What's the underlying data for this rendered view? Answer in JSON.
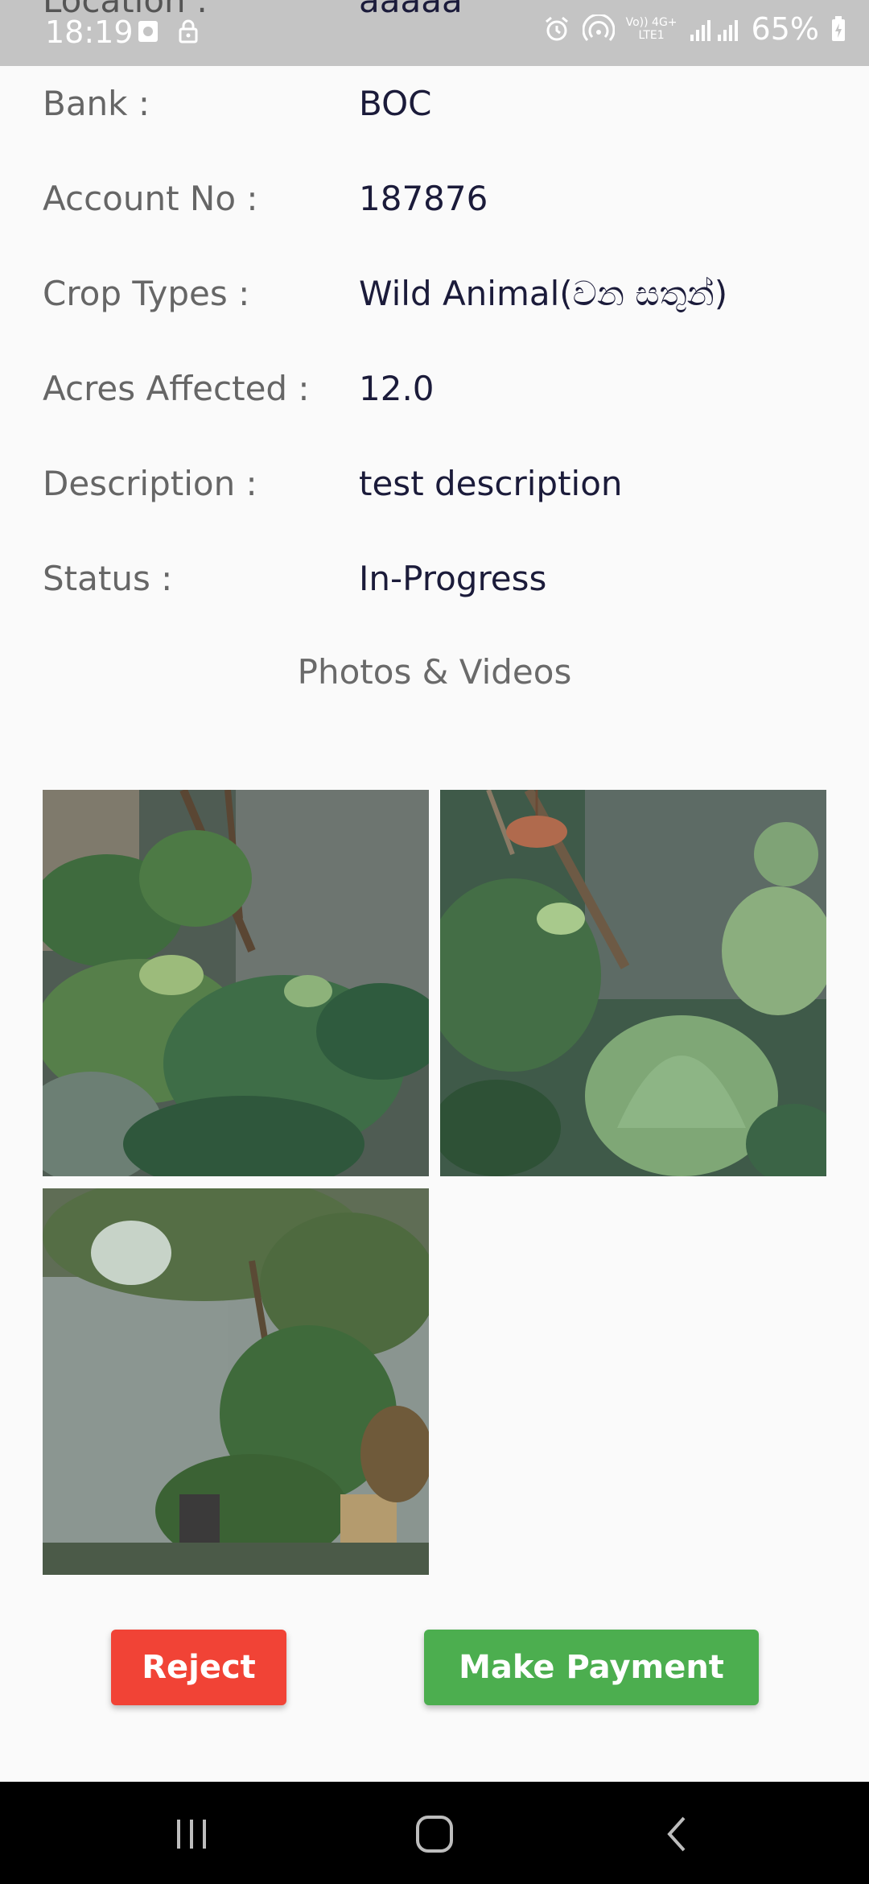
{
  "status_bar": {
    "time": "18:19",
    "battery": "65%",
    "network_line1": "Vo)) 4G+",
    "network_line2": "LTE1",
    "icons": [
      "photo-icon",
      "lock-icon",
      "alarm-icon",
      "hotspot-icon",
      "signal-icon",
      "battery-icon"
    ]
  },
  "details": {
    "location": {
      "label": "Location :",
      "value": "aaaaa"
    },
    "bank": {
      "label": "Bank :",
      "value": "BOC"
    },
    "account": {
      "label": "Account No :",
      "value": "187876"
    },
    "crop": {
      "label": "Crop Types :",
      "value": "Wild Animal(වන සතුන්)"
    },
    "acres": {
      "label": "Acres Affected :",
      "value": "12.0"
    },
    "description": {
      "label": "Description :",
      "value": "test description"
    },
    "status": {
      "label": "Status :",
      "value": "In-Progress"
    }
  },
  "media": {
    "title": "Photos & Videos",
    "photos": [
      "garden-photo",
      "garden-photo",
      "garden-photo"
    ]
  },
  "actions": {
    "reject_label": "Reject",
    "pay_label": "Make Payment"
  },
  "navigation": {
    "icons": [
      "recent-apps-icon",
      "home-icon",
      "back-icon"
    ]
  },
  "colors": {
    "reject": "#f14336",
    "pay": "#4cae4f",
    "status_bar": "#c4c4c4",
    "nav_bar": "#000000"
  }
}
